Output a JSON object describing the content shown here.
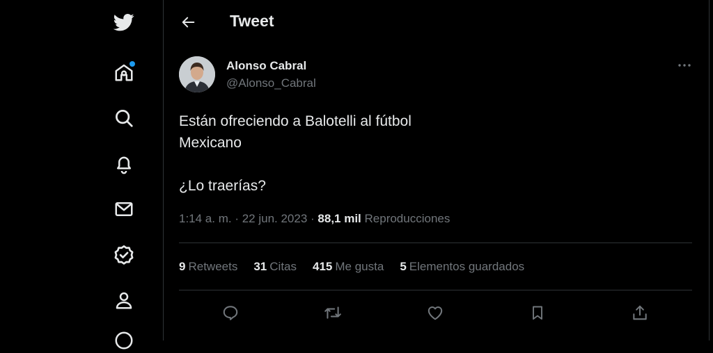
{
  "header": {
    "title": "Tweet"
  },
  "sidebar": {
    "items": [
      {
        "icon": "twitter-bird-icon"
      },
      {
        "icon": "home-icon",
        "has_notification_dot": true
      },
      {
        "icon": "search-icon"
      },
      {
        "icon": "bell-icon"
      },
      {
        "icon": "mail-icon"
      },
      {
        "icon": "verified-icon"
      },
      {
        "icon": "profile-icon"
      },
      {
        "icon": "more-circle-icon"
      }
    ]
  },
  "tweet": {
    "author_name": "Alonso Cabral",
    "author_handle": "@Alonso_Cabral",
    "text": "Están ofreciendo a Balotelli al fútbol\nMexicano\n\n¿Lo traerías?",
    "timestamp": "1:14 a. m. · 22 jun. 2023 · ",
    "views_count": "88,1 mil",
    "views_label": " Reproducciones"
  },
  "stats": {
    "retweets_count": "9",
    "retweets_label": "Retweets",
    "quotes_count": "31",
    "quotes_label": "Citas",
    "likes_count": "415",
    "likes_label": "Me gusta",
    "bookmarks_count": "5",
    "bookmarks_label": "Elementos guardados"
  },
  "colors": {
    "background": "#000000",
    "text": "#e7e9ea",
    "muted": "#71767b",
    "accent": "#1d9bf0",
    "border": "#2f3336"
  }
}
